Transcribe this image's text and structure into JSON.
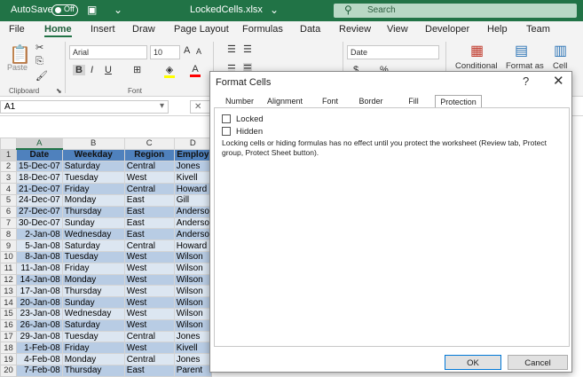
{
  "titlebar": {
    "autosave": "AutoSave",
    "toggle": "Off",
    "filename": "LockedCells.xlsx",
    "search": "Search"
  },
  "menu": [
    "File",
    "Home",
    "Insert",
    "Draw",
    "Page Layout",
    "Formulas",
    "Data",
    "Review",
    "View",
    "Developer",
    "Help",
    "Team"
  ],
  "ribbon": {
    "paste": "Paste",
    "clipboard": "Clipboard",
    "font_name": "Arial",
    "font_size": "10",
    "font_group": "Font",
    "number_format": "Date",
    "conditional": "Conditional",
    "format_as": "Format as",
    "cell": "Cell",
    "bold": "B",
    "italic": "I",
    "underline": "U"
  },
  "namebox": "A1",
  "columns": [
    "A",
    "B",
    "C",
    "D"
  ],
  "rows": [
    {
      "n": "1",
      "date": "Date",
      "wd": "Weekday",
      "rg": "Region",
      "em": "Employ"
    },
    {
      "n": "2",
      "date": "15-Dec-07",
      "wd": "Saturday",
      "rg": "Central",
      "em": "Jones"
    },
    {
      "n": "3",
      "date": "18-Dec-07",
      "wd": "Tuesday",
      "rg": "West",
      "em": "Kivell"
    },
    {
      "n": "4",
      "date": "21-Dec-07",
      "wd": "Friday",
      "rg": "Central",
      "em": "Howard"
    },
    {
      "n": "5",
      "date": "24-Dec-07",
      "wd": "Monday",
      "rg": "East",
      "em": "Gill"
    },
    {
      "n": "6",
      "date": "27-Dec-07",
      "wd": "Thursday",
      "rg": "East",
      "em": "Anderso"
    },
    {
      "n": "7",
      "date": "30-Dec-07",
      "wd": "Sunday",
      "rg": "East",
      "em": "Anderso"
    },
    {
      "n": "8",
      "date": "2-Jan-08",
      "wd": "Wednesday",
      "rg": "East",
      "em": "Anderso"
    },
    {
      "n": "9",
      "date": "5-Jan-08",
      "wd": "Saturday",
      "rg": "Central",
      "em": "Howard"
    },
    {
      "n": "10",
      "date": "8-Jan-08",
      "wd": "Tuesday",
      "rg": "West",
      "em": "Wilson"
    },
    {
      "n": "11",
      "date": "11-Jan-08",
      "wd": "Friday",
      "rg": "West",
      "em": "Wilson"
    },
    {
      "n": "12",
      "date": "14-Jan-08",
      "wd": "Monday",
      "rg": "West",
      "em": "Wilson"
    },
    {
      "n": "13",
      "date": "17-Jan-08",
      "wd": "Thursday",
      "rg": "West",
      "em": "Wilson"
    },
    {
      "n": "14",
      "date": "20-Jan-08",
      "wd": "Sunday",
      "rg": "West",
      "em": "Wilson"
    },
    {
      "n": "15",
      "date": "23-Jan-08",
      "wd": "Wednesday",
      "rg": "West",
      "em": "Wilson"
    },
    {
      "n": "16",
      "date": "26-Jan-08",
      "wd": "Saturday",
      "rg": "West",
      "em": "Wilson"
    },
    {
      "n": "17",
      "date": "29-Jan-08",
      "wd": "Tuesday",
      "rg": "Central",
      "em": "Jones"
    },
    {
      "n": "18",
      "date": "1-Feb-08",
      "wd": "Friday",
      "rg": "West",
      "em": "Kivell"
    },
    {
      "n": "19",
      "date": "4-Feb-08",
      "wd": "Monday",
      "rg": "Central",
      "em": "Jones"
    },
    {
      "n": "20",
      "date": "7-Feb-08",
      "wd": "Thursday",
      "rg": "East",
      "em": "Parent"
    }
  ],
  "dialog": {
    "title": "Format Cells",
    "help": "?",
    "close": "✕",
    "tabs": [
      "Number",
      "Alignment",
      "Font",
      "Border",
      "Fill",
      "Protection"
    ],
    "locked": "Locked",
    "hidden": "Hidden",
    "note": "Locking cells or hiding formulas has no effect until you protect the worksheet (Review tab, Protect group, Protect Sheet button).",
    "ok": "OK",
    "cancel": "Cancel"
  }
}
